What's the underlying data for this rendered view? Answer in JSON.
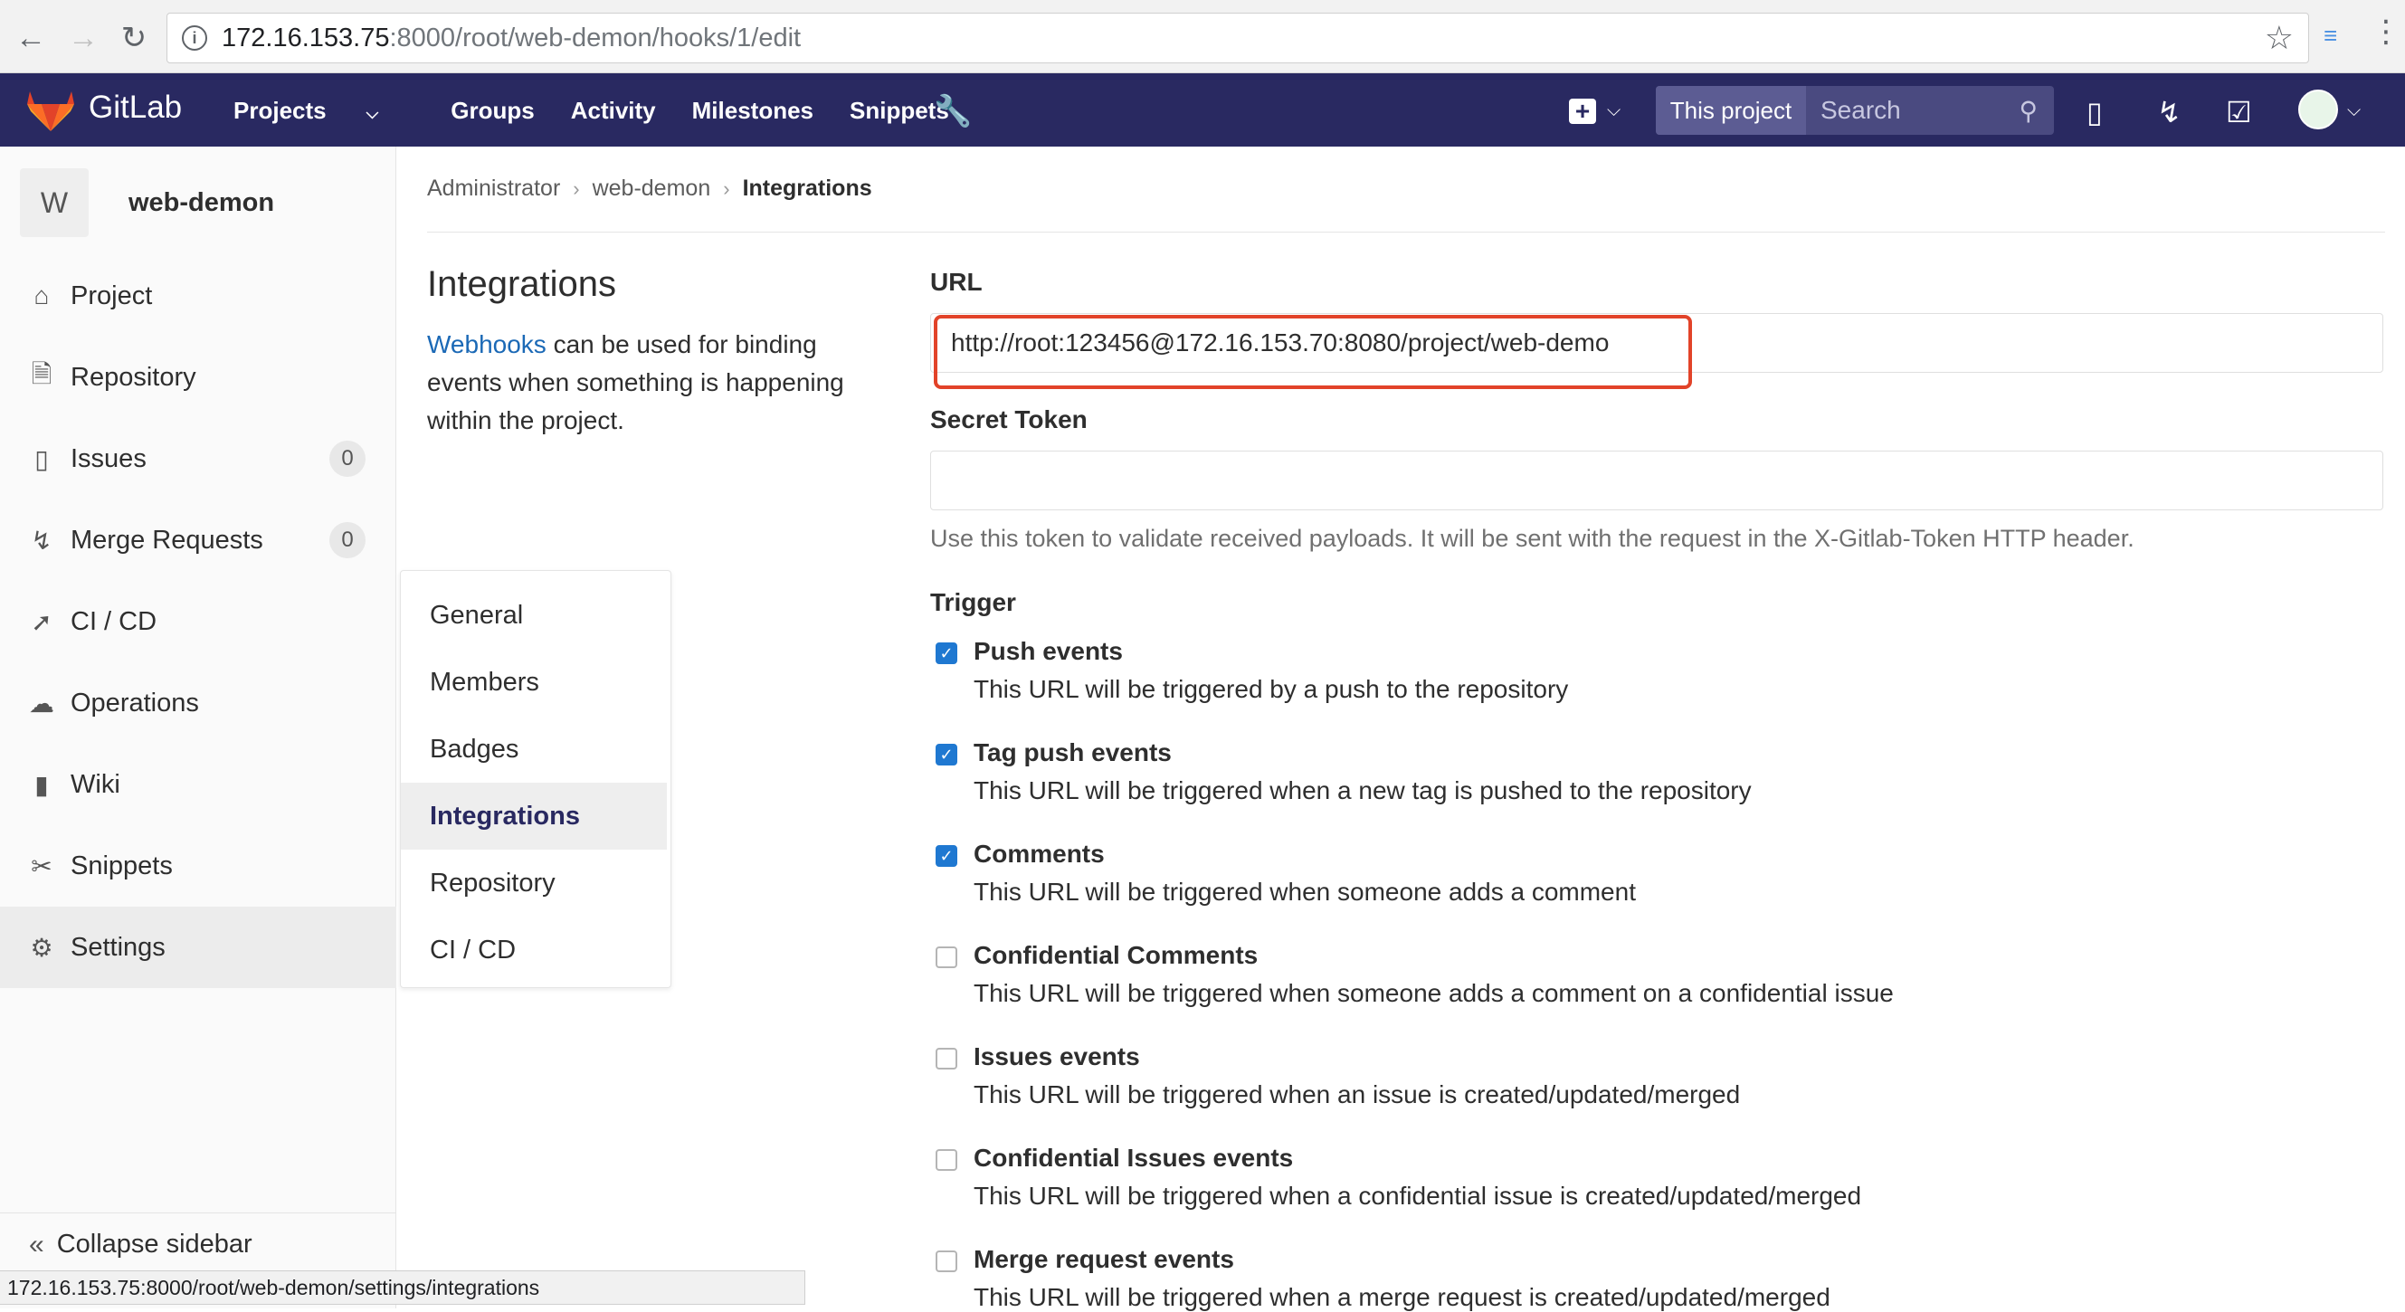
{
  "browser": {
    "url_host": "172.16.153.75",
    "url_path": ":8000/root/web-demon/hooks/1/edit",
    "status_url": "172.16.153.75:8000/root/web-demon/settings/integrations"
  },
  "header": {
    "brand": "GitLab",
    "nav": [
      "Projects",
      "Groups",
      "Activity",
      "Milestones",
      "Snippets"
    ],
    "search_scope": "This project",
    "search_placeholder": "Search"
  },
  "sidebar": {
    "project_initial": "W",
    "project_name": "web-demon",
    "items": [
      {
        "label": "Project",
        "icon": "home-icon"
      },
      {
        "label": "Repository",
        "icon": "repository-icon"
      },
      {
        "label": "Issues",
        "icon": "issues-icon",
        "count": "0"
      },
      {
        "label": "Merge Requests",
        "icon": "merge-request-icon",
        "count": "0"
      },
      {
        "label": "CI / CD",
        "icon": "rocket-icon"
      },
      {
        "label": "Operations",
        "icon": "cloud-gear-icon"
      },
      {
        "label": "Wiki",
        "icon": "book-icon"
      },
      {
        "label": "Snippets",
        "icon": "scissors-icon"
      },
      {
        "label": "Settings",
        "icon": "gear-icon"
      }
    ],
    "collapse_label": "Collapse sidebar",
    "flyout": [
      "General",
      "Members",
      "Badges",
      "Integrations",
      "Repository",
      "CI / CD"
    ]
  },
  "breadcrumb": [
    "Administrator",
    "web-demon",
    "Integrations"
  ],
  "page": {
    "title": "Integrations",
    "desc_link": "Webhooks",
    "desc_rest": " can be used for binding events when something is happening within the project."
  },
  "form": {
    "url_label": "URL",
    "url_value": "http://root:123456@172.16.153.70:8080/project/web-demo",
    "token_label": "Secret Token",
    "token_help": "Use this token to validate received payloads. It will be sent with the request in the X-Gitlab-Token HTTP header.",
    "trigger_label": "Trigger",
    "triggers": [
      {
        "name": "Push events",
        "desc": "This URL will be triggered by a push to the repository",
        "checked": true
      },
      {
        "name": "Tag push events",
        "desc": "This URL will be triggered when a new tag is pushed to the repository",
        "checked": true
      },
      {
        "name": "Comments",
        "desc": "This URL will be triggered when someone adds a comment",
        "checked": true
      },
      {
        "name": "Confidential Comments",
        "desc": "This URL will be triggered when someone adds a comment on a confidential issue",
        "checked": false
      },
      {
        "name": "Issues events",
        "desc": "This URL will be triggered when an issue is created/updated/merged",
        "checked": false
      },
      {
        "name": "Confidential Issues events",
        "desc": "This URL will be triggered when a confidential issue is created/updated/merged",
        "checked": false
      },
      {
        "name": "Merge request events",
        "desc": "This URL will be triggered when a merge request is created/updated/merged",
        "checked": false
      }
    ]
  },
  "colors": {
    "header_bg": "#292961",
    "highlight": "#e24329",
    "link": "#1b69b6",
    "checkbox": "#1f78d1"
  }
}
